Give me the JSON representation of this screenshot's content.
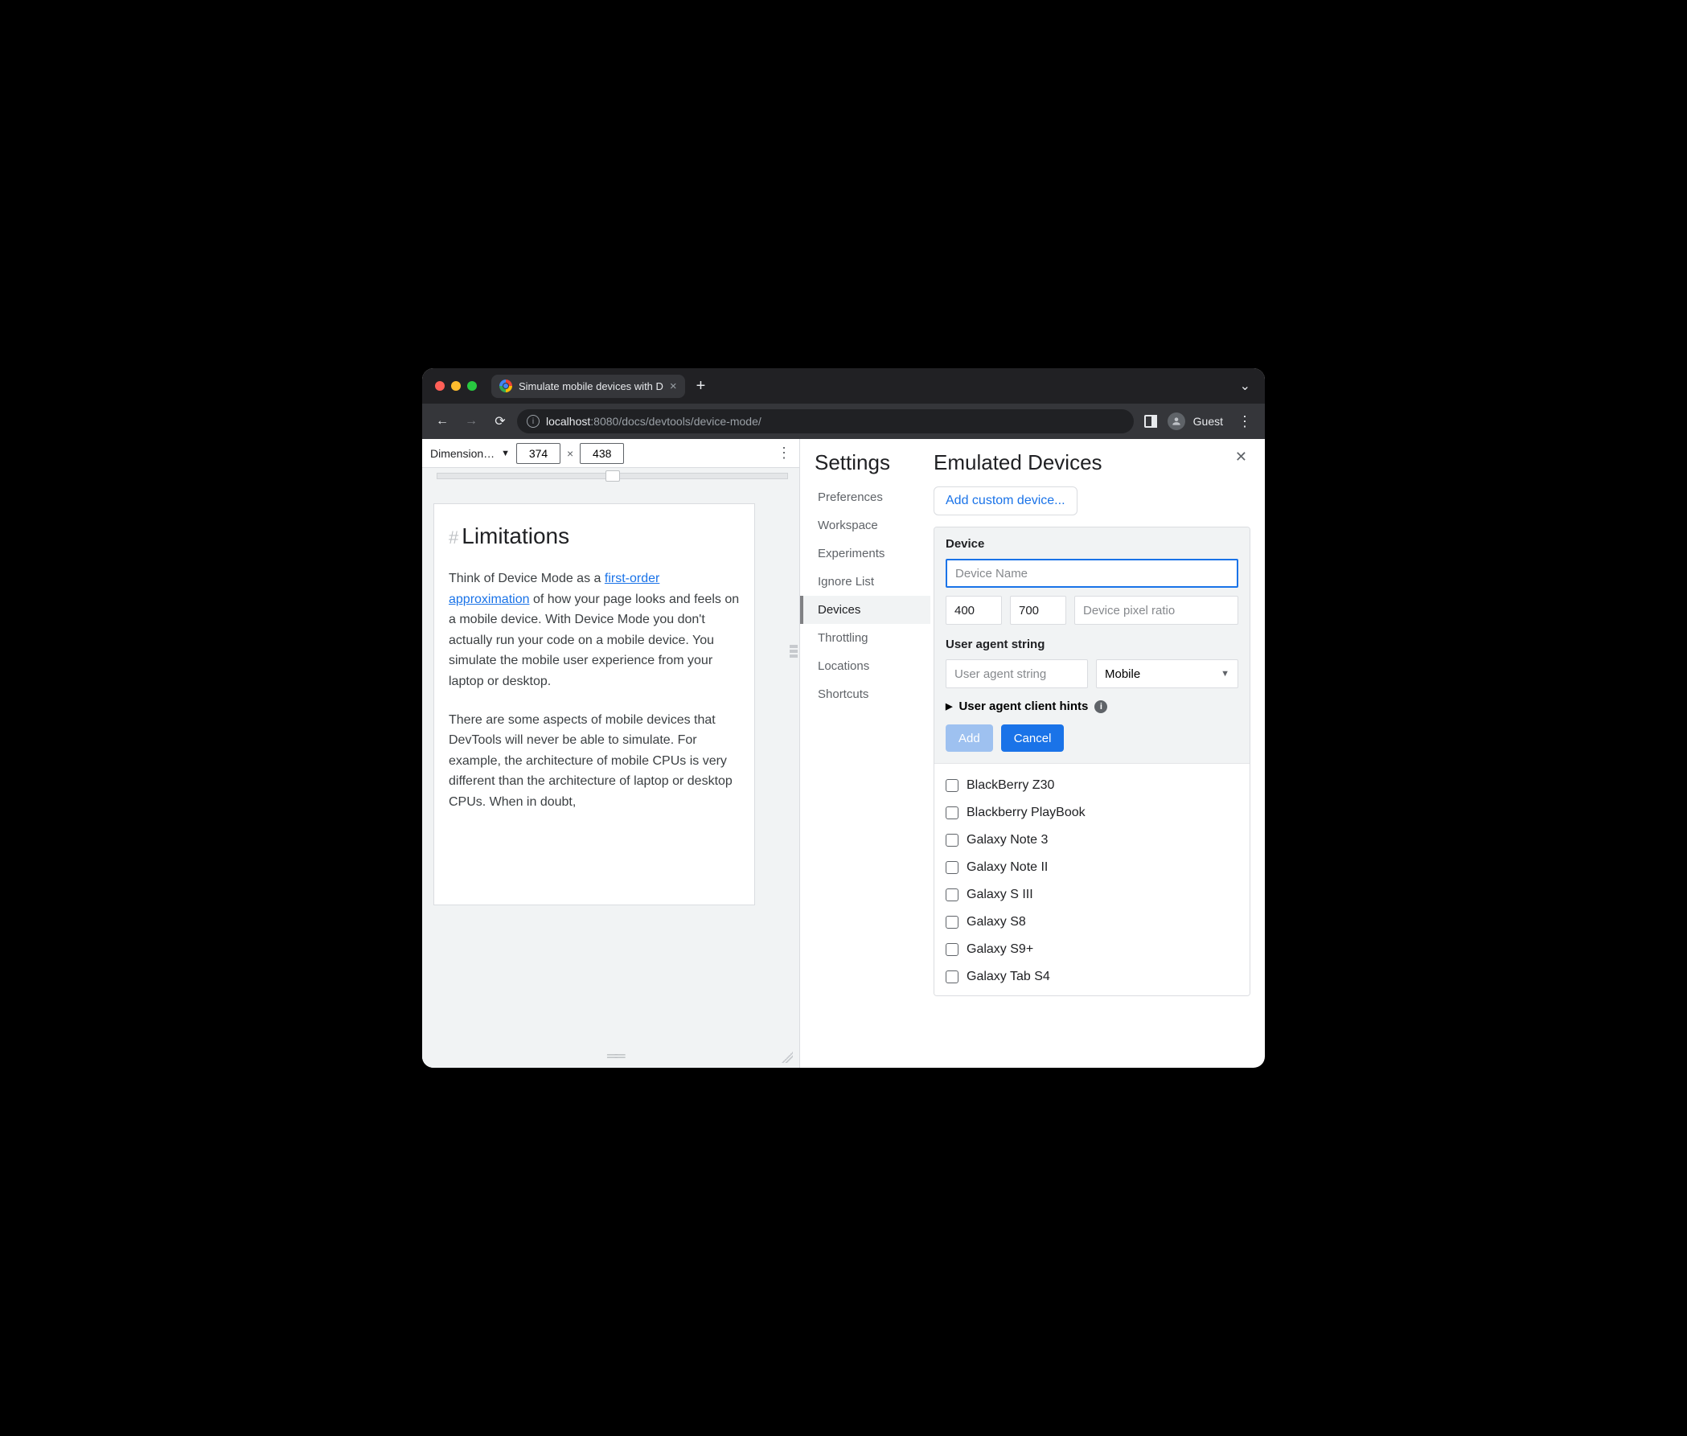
{
  "tab": {
    "title": "Simulate mobile devices with D"
  },
  "url": {
    "host_dim": "localhost",
    "port": ":8080",
    "path": "/docs/devtools/device-mode/"
  },
  "chrome": {
    "guest": "Guest"
  },
  "device_toolbar": {
    "dimensions_label": "Dimension…",
    "width": "374",
    "height": "438",
    "times": "×"
  },
  "page": {
    "heading": "Limitations",
    "p1_a": "Think of Device Mode as a ",
    "p1_link": "first-order approximation",
    "p1_b": " of how your page looks and feels on a mobile device. With Device Mode you don't actually run your code on a mobile device. You simulate the mobile user experience from your laptop or desktop.",
    "p2": "There are some aspects of mobile devices that DevTools will never be able to simulate. For example, the architecture of mobile CPUs is very different than the architecture of laptop or desktop CPUs. When in doubt,"
  },
  "settings": {
    "title": "Settings",
    "nav": [
      "Preferences",
      "Workspace",
      "Experiments",
      "Ignore List",
      "Devices",
      "Throttling",
      "Locations",
      "Shortcuts"
    ],
    "active": "Devices"
  },
  "emulated": {
    "title": "Emulated Devices",
    "add_custom": "Add custom device...",
    "device_label": "Device",
    "name_placeholder": "Device Name",
    "width": "400",
    "height": "700",
    "dpr_placeholder": "Device pixel ratio",
    "ua_label": "User agent string",
    "ua_placeholder": "User agent string",
    "ua_type": "Mobile",
    "hints": "User agent client hints",
    "add_btn": "Add",
    "cancel_btn": "Cancel",
    "list": [
      "BlackBerry Z30",
      "Blackberry PlayBook",
      "Galaxy Note 3",
      "Galaxy Note II",
      "Galaxy S III",
      "Galaxy S8",
      "Galaxy S9+",
      "Galaxy Tab S4"
    ]
  }
}
